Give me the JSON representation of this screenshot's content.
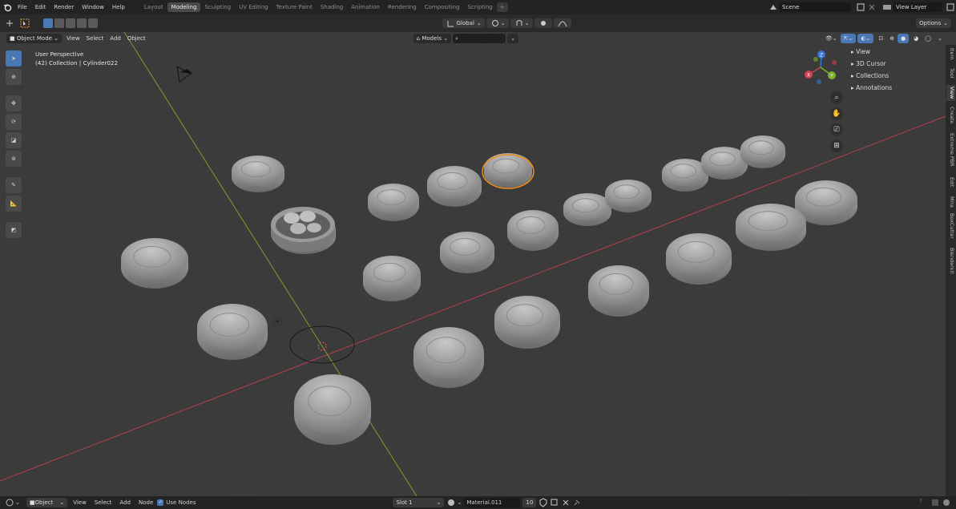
{
  "menu": {
    "items": [
      "File",
      "Edit",
      "Render",
      "Window",
      "Help"
    ]
  },
  "workspaces": [
    "Layout",
    "Modeling",
    "Sculpting",
    "UV Editing",
    "Texture Paint",
    "Shading",
    "Animation",
    "Rendering",
    "Compositing",
    "Scripting"
  ],
  "active_workspace": "Modeling",
  "add_workspace": "+",
  "scene": {
    "name": "Scene"
  },
  "view_layer": {
    "name": "View Layer"
  },
  "tool_header": {
    "orientation": "Global",
    "options_label": "Options"
  },
  "viewport_header": {
    "mode": "Object Mode",
    "menus": [
      "View",
      "Select",
      "Add",
      "Object"
    ],
    "collection_filter": "Models",
    "search_placeholder": ""
  },
  "overlay_text": {
    "perspective": "User Perspective",
    "collection_info": "(42) Collection | Cylinder022"
  },
  "npanel": {
    "items": [
      "View",
      "3D Cursor",
      "Collections",
      "Annotations"
    ]
  },
  "side_tabs": [
    "Item",
    "Tool",
    "View",
    "Create",
    "Extreme PBR",
    "Edit",
    "Mira",
    "BoxCutter",
    "Blenderkit"
  ],
  "active_side_tab": "View",
  "gizmo_axes": {
    "x": "X",
    "y": "Y",
    "z": "Z"
  },
  "bottom_bar": {
    "object_label": "Object",
    "menus": [
      "View",
      "Select",
      "Add",
      "Node"
    ],
    "use_nodes_label": "Use Nodes",
    "use_nodes_checked": true,
    "slot": "Slot 1",
    "material": "Material.011",
    "user_count": "10"
  },
  "colors": {
    "accent": "#4a78b4",
    "selection_outline": "#f0901a",
    "x_axis": "#b5404a",
    "y_axis": "#7aa02a"
  }
}
